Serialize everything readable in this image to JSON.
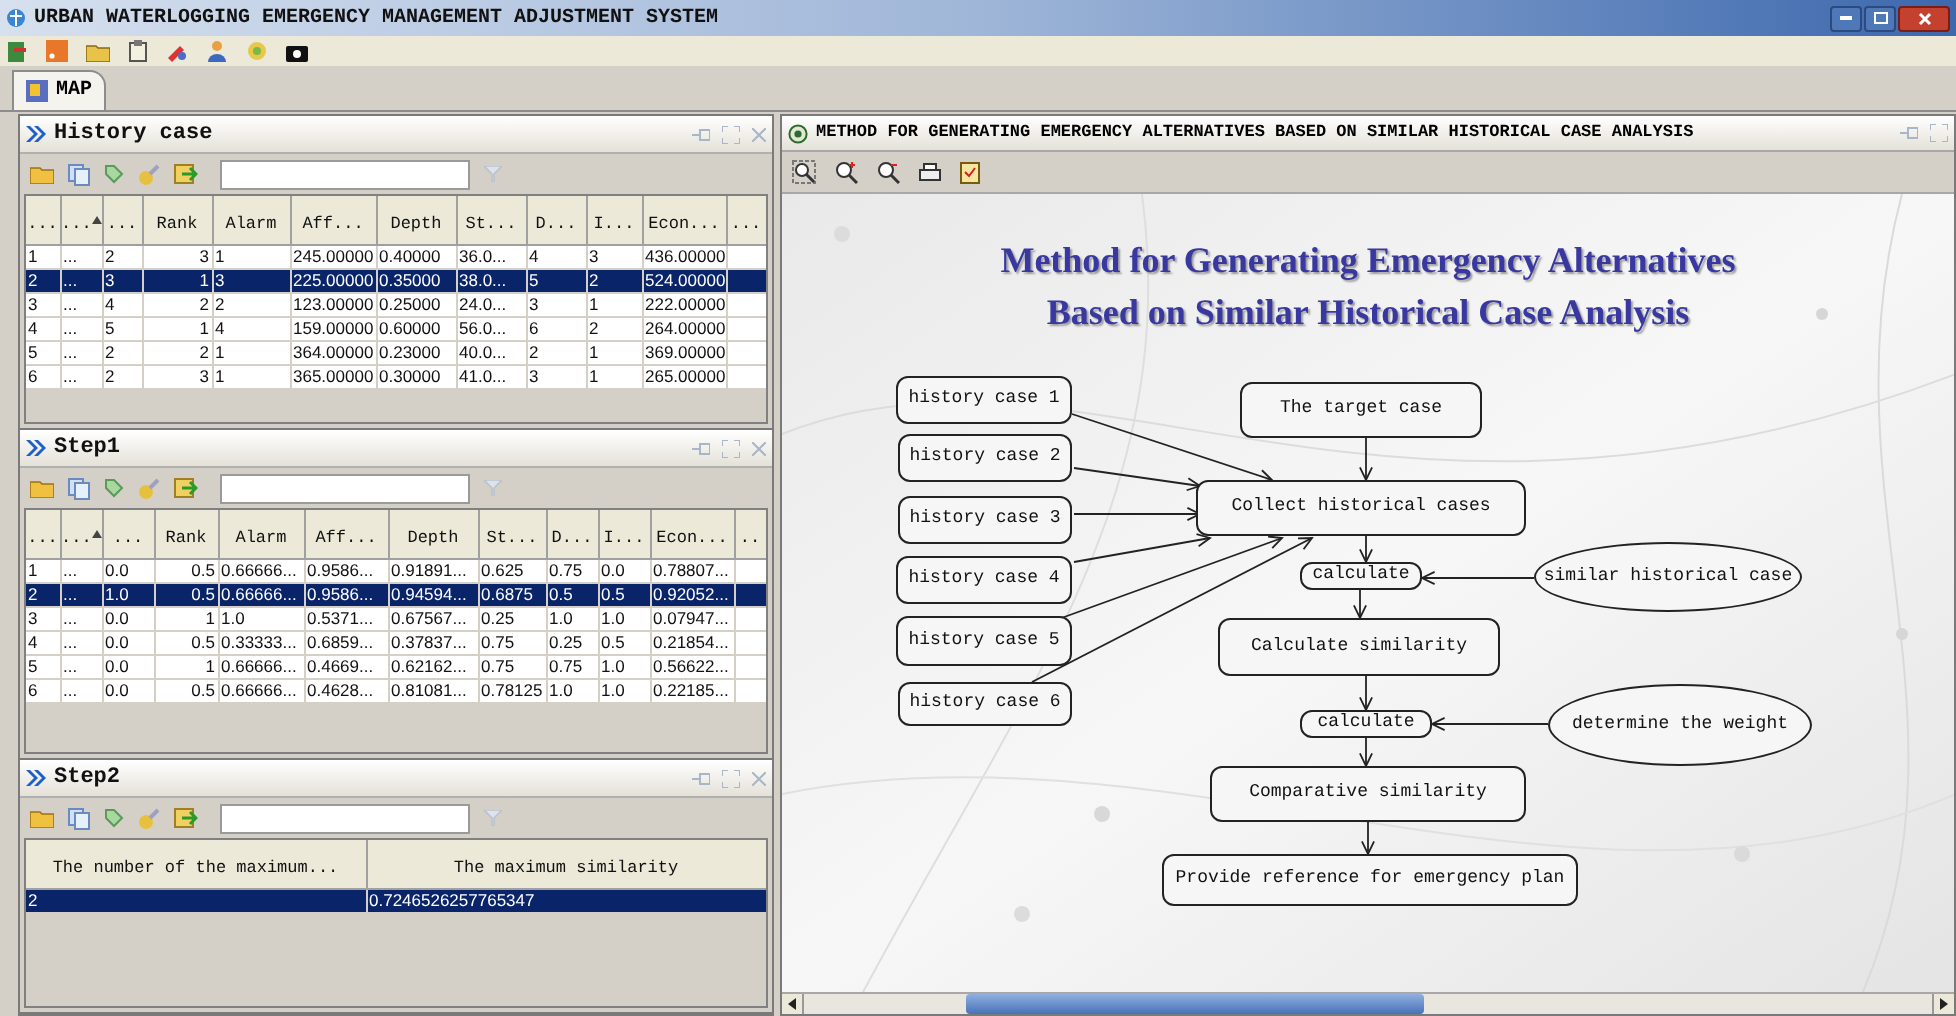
{
  "window": {
    "title": "URBAN WATERLOGGING EMERGENCY MANAGEMENT ADJUSTMENT SYSTEM"
  },
  "tabs": [
    {
      "label": "MAP",
      "selected": true
    }
  ],
  "panels": [
    {
      "title": "History case",
      "table": {
        "columns": [
          {
            "label": "...",
            "sorted": false
          },
          {
            "label": "...",
            "sorted": true
          },
          {
            "label": "...",
            "sorted": false
          },
          {
            "label": "Rank",
            "sorted": false
          },
          {
            "label": "Alarm",
            "sorted": false
          },
          {
            "label": "Aff...",
            "sorted": false
          },
          {
            "label": "Depth",
            "sorted": false
          },
          {
            "label": "St...",
            "sorted": false
          },
          {
            "label": "D...",
            "sorted": false
          },
          {
            "label": "I...",
            "sorted": false
          },
          {
            "label": "Econ...",
            "sorted": false
          },
          {
            "label": "...",
            "sorted": false
          }
        ],
        "rows": [
          {
            "cells": [
              "1",
              "...",
              "2",
              "3",
              "1",
              "245.00000",
              "0.40000",
              "36.0...",
              "4",
              "3",
              "436.00000"
            ],
            "selected": false
          },
          {
            "cells": [
              "2",
              "...",
              "3",
              "1",
              "3",
              "225.00000",
              "0.35000",
              "38.0...",
              "5",
              "2",
              "524.00000"
            ],
            "selected": true
          },
          {
            "cells": [
              "3",
              "...",
              "4",
              "2",
              "2",
              "123.00000",
              "0.25000",
              "24.0...",
              "3",
              "1",
              "222.00000"
            ],
            "selected": false
          },
          {
            "cells": [
              "4",
              "...",
              "5",
              "1",
              "4",
              "159.00000",
              "0.60000",
              "56.0...",
              "6",
              "2",
              "264.00000"
            ],
            "selected": false
          },
          {
            "cells": [
              "5",
              "...",
              "2",
              "2",
              "1",
              "364.00000",
              "0.23000",
              "40.0...",
              "2",
              "1",
              "369.00000"
            ],
            "selected": false
          },
          {
            "cells": [
              "6",
              "...",
              "2",
              "3",
              "1",
              "365.00000",
              "0.30000",
              "41.0...",
              "3",
              "1",
              "265.00000"
            ],
            "selected": false
          }
        ]
      }
    },
    {
      "title": "Step1",
      "table": {
        "columns": [
          {
            "label": "...",
            "sorted": false
          },
          {
            "label": "...",
            "sorted": true
          },
          {
            "label": "...",
            "sorted": false
          },
          {
            "label": "Rank",
            "sorted": false
          },
          {
            "label": "Alarm",
            "sorted": false
          },
          {
            "label": "Aff...",
            "sorted": false
          },
          {
            "label": "Depth",
            "sorted": false
          },
          {
            "label": "St...",
            "sorted": false
          },
          {
            "label": "D...",
            "sorted": false
          },
          {
            "label": "I...",
            "sorted": false
          },
          {
            "label": "Econ...",
            "sorted": false
          },
          {
            "label": "..",
            "sorted": false
          }
        ],
        "rows": [
          {
            "cells": [
              "1",
              "...",
              "0.0",
              "0.5",
              "0.66666...",
              "0.9586...",
              "0.91891...",
              "0.625",
              "0.75",
              "0.0",
              "0.78807..."
            ],
            "selected": false
          },
          {
            "cells": [
              "2",
              "...",
              "1.0",
              "0.5",
              "0.66666...",
              "0.9586...",
              "0.94594...",
              "0.6875",
              "0.5",
              "0.5",
              "0.92052..."
            ],
            "selected": true
          },
          {
            "cells": [
              "3",
              "...",
              "0.0",
              "1",
              "1.0",
              "0.5371...",
              "0.67567...",
              "0.25",
              "1.0",
              "1.0",
              "0.07947..."
            ],
            "selected": false
          },
          {
            "cells": [
              "4",
              "...",
              "0.0",
              "0.5",
              "0.33333...",
              "0.6859...",
              "0.37837...",
              "0.75",
              "0.25",
              "0.5",
              "0.21854..."
            ],
            "selected": false
          },
          {
            "cells": [
              "5",
              "...",
              "0.0",
              "1",
              "0.66666...",
              "0.4669...",
              "0.62162...",
              "0.75",
              "0.75",
              "1.0",
              "0.56622..."
            ],
            "selected": false
          },
          {
            "cells": [
              "6",
              "...",
              "0.0",
              "0.5",
              "0.66666...",
              "0.4628...",
              "0.81081...",
              "0.78125",
              "1.0",
              "1.0",
              "0.22185..."
            ],
            "selected": false
          }
        ]
      }
    },
    {
      "title": "Step2",
      "table": {
        "columns": [
          {
            "label": "The number of the maximum...",
            "sorted": false
          },
          {
            "label": "The maximum similarity",
            "sorted": false
          }
        ],
        "rows": [
          {
            "cells": [
              "2",
              "0.7246526257765347"
            ],
            "selected": true
          }
        ]
      }
    }
  ],
  "diagram_panel": {
    "title": "METHOD FOR GENERATING EMERGENCY ALTERNATIVES BASED ON SIMILAR HISTORICAL CASE ANALYSIS",
    "heading": [
      "Method for Generating Emergency Alternatives",
      "Based on Similar Historical Case Analysis"
    ],
    "nodes": [
      {
        "label": "history case 1",
        "kind": "box"
      },
      {
        "label": "history case 2",
        "kind": "box"
      },
      {
        "label": "history case 3",
        "kind": "box"
      },
      {
        "label": "history case 4",
        "kind": "box"
      },
      {
        "label": "history case 5",
        "kind": "box"
      },
      {
        "label": "history case 6",
        "kind": "box"
      },
      {
        "label": "The target case",
        "kind": "box"
      },
      {
        "label": "Collect historical cases",
        "kind": "box"
      },
      {
        "label": "calculate",
        "kind": "box"
      },
      {
        "label": "similar historical case",
        "kind": "ellipse"
      },
      {
        "label": "Calculate similarity",
        "kind": "box"
      },
      {
        "label": "calculate",
        "kind": "box"
      },
      {
        "label": "determine the weight",
        "kind": "ellipse"
      },
      {
        "label": "Comparative similarity",
        "kind": "box"
      },
      {
        "label": "Provide reference for emergency plan",
        "kind": "box"
      }
    ]
  }
}
